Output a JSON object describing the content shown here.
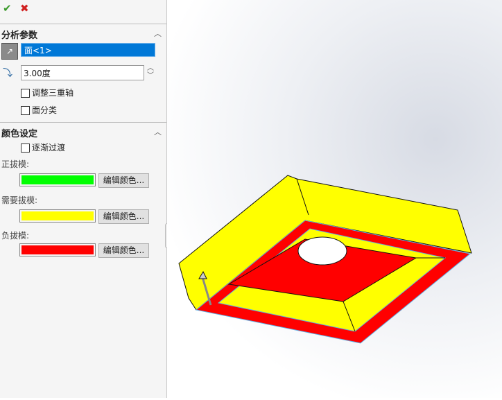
{
  "toolbar": {
    "ok_icon": "check-icon",
    "cancel_icon": "close-icon"
  },
  "analysis": {
    "title": "分析参数",
    "face_value": "面<1>",
    "angle_value": "3.00度",
    "adjust_triad": "调整三重轴",
    "face_classify": "面分类"
  },
  "colors": {
    "title": "颜色设定",
    "gradual": "逐渐过渡",
    "items": [
      {
        "label": "正拔模:",
        "color": "#00ff00",
        "button": "编辑颜色..."
      },
      {
        "label": "需要拔模:",
        "color": "#ffff00",
        "button": "编辑颜色..."
      },
      {
        "label": "负拔模:",
        "color": "#ff0000",
        "button": "编辑颜色..."
      }
    ]
  }
}
